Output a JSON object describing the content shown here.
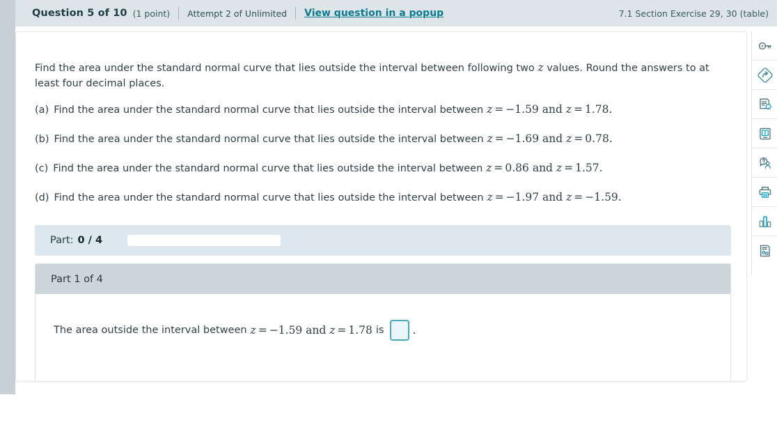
{
  "header": {
    "title": "Question 5 of 10",
    "points": "(1 point)",
    "attempt": "Attempt 2 of Unlimited",
    "popup_link": "View question in a popup",
    "exercise": "7.1 Section Exercise 29, 30 (table)"
  },
  "prompt": {
    "text": "Find the area under the standard normal curve that lies outside the interval between following two z values. Round the answers to at least four decimal places.",
    "text_before_z": "Find the area under the standard normal curve that lies outside the interval between following two ",
    "z_symbol": "z",
    "text_after_z": " values. Round the answers to at least four decimal places."
  },
  "subquestions": [
    {
      "label": "(a)",
      "text": "Find the area under the standard normal curve that lies outside the interval between",
      "z1": "−1.59",
      "z2": "1.78"
    },
    {
      "label": "(b)",
      "text": "Find the area under the standard normal curve that lies outside the interval between",
      "z1": "−1.69",
      "z2": "0.78"
    },
    {
      "label": "(c)",
      "text": "Find the area under the standard normal curve that lies outside the interval between",
      "z1": "0.86",
      "z2": "1.57"
    },
    {
      "label": "(d)",
      "text": "Find the area under the standard normal curve that lies outside the interval between",
      "z1": "−1.97",
      "z2": "−1.59"
    }
  ],
  "part_progress": {
    "label": "Part:",
    "count": "0 / 4",
    "completed": 0,
    "total": 4,
    "percent": 0
  },
  "part_panel": {
    "heading": "Part 1 of 4",
    "answer_prefix": "The area outside the interval between",
    "z1": "−1.59",
    "z2": "1.78",
    "answer_middle": "is",
    "answer_value": "",
    "answer_placeholder": "",
    "trailing_period": "."
  },
  "tools": [
    {
      "name": "key-icon",
      "title": "Answer key"
    },
    {
      "name": "submit-arrow-icon",
      "title": "Submit"
    },
    {
      "name": "hint-document-icon",
      "title": "Hint"
    },
    {
      "name": "ebook-icon",
      "title": "eBook"
    },
    {
      "name": "ask-instructor-icon",
      "title": "Ask my instructor"
    },
    {
      "name": "print-icon",
      "title": "Print"
    },
    {
      "name": "statistics-chart-icon",
      "title": "Statistics tools"
    },
    {
      "name": "scratch-work-icon",
      "title": "Scratch work"
    }
  ],
  "colors": {
    "accent_link": "#0a7b94",
    "header_bg": "#dde5e8",
    "left_rail": "#c6d0d6",
    "progress_bg": "#dce7ef",
    "part_head_bg": "#ccd6da",
    "input_border": "#4aa9bf",
    "icon_dark": "#4a707c",
    "icon_bright": "#13a4c9"
  }
}
